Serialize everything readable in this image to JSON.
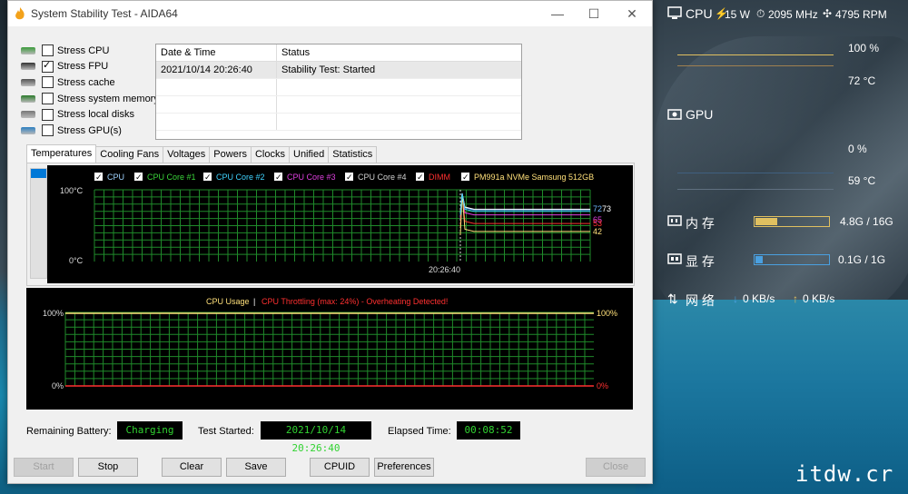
{
  "window": {
    "title": "System Stability Test - AIDA64"
  },
  "stress_options": [
    {
      "label": "Stress CPU",
      "checked": false,
      "icon": "cpu-chip-icon"
    },
    {
      "label": "Stress FPU",
      "checked": true,
      "icon": "fpu-123-icon"
    },
    {
      "label": "Stress cache",
      "checked": false,
      "icon": "cache-icon"
    },
    {
      "label": "Stress system memory",
      "checked": false,
      "icon": "memory-module-icon"
    },
    {
      "label": "Stress local disks",
      "checked": false,
      "icon": "disk-icon"
    },
    {
      "label": "Stress GPU(s)",
      "checked": false,
      "icon": "gpu-icon"
    }
  ],
  "log": {
    "col_datetime": "Date & Time",
    "col_status": "Status",
    "rows": [
      {
        "datetime": "2021/10/14 20:26:40",
        "status": "Stability Test: Started"
      }
    ]
  },
  "tabs": [
    "Temperatures",
    "Cooling Fans",
    "Voltages",
    "Powers",
    "Clocks",
    "Unified",
    "Statistics"
  ],
  "temp_chart": {
    "legend": [
      {
        "label": "CPU",
        "color": "#9fd3ff"
      },
      {
        "label": "CPU Core #1",
        "color": "#3ad43a"
      },
      {
        "label": "CPU Core #2",
        "color": "#3fd3ff"
      },
      {
        "label": "CPU Core #3",
        "color": "#e040e0"
      },
      {
        "label": "CPU Core #4",
        "color": "#d0d0d0"
      },
      {
        "label": "DIMM",
        "color": "#ff3030"
      },
      {
        "label": "PM991a NVMe Samsung 512GB",
        "color": "#ffe07a"
      }
    ],
    "y_top": "100°C",
    "y_bottom": "0°C",
    "x_label": "20:26:40",
    "values": [
      {
        "label": "72",
        "color": "#6fb8ff"
      },
      {
        "label": "73",
        "color": "#ffffff"
      },
      {
        "label": "65",
        "color": "#e040e0"
      },
      {
        "label": "53",
        "color": "#ff3030"
      },
      {
        "label": "42",
        "color": "#ffe07a"
      }
    ]
  },
  "usage_chart": {
    "title_left": "CPU Usage",
    "separator": "|",
    "title_right": "CPU Throttling (max: 24%) - Overheating Detected!",
    "left_top": "100%",
    "left_bottom": "0%",
    "right_top": "100%",
    "right_bottom": "0%"
  },
  "status_bar": {
    "battery_label": "Remaining Battery:",
    "battery_value": "Charging",
    "started_label": "Test Started:",
    "started_value": "2021/10/14 20:26:40",
    "elapsed_label": "Elapsed Time:",
    "elapsed_value": "00:08:52"
  },
  "buttons": {
    "start": "Start",
    "stop": "Stop",
    "clear": "Clear",
    "save": "Save",
    "cpuid": "CPUID",
    "preferences": "Preferences",
    "close": "Close"
  },
  "overlay": {
    "cpu_label": "CPU",
    "cpu_power": "15 W",
    "cpu_clock": "2095 MHz",
    "cpu_fan": "4795 RPM",
    "cpu_usage": "100 %",
    "cpu_temp": "72 °C",
    "gpu_label": "GPU",
    "gpu_usage": "0 %",
    "gpu_temp": "59 °C",
    "mem_label": "内 存",
    "mem_value": "4.8G / 16G",
    "vram_label": "显 存",
    "vram_value": "0.1G / 1G",
    "net_label": "网 络",
    "net_down": "0 KB/s",
    "net_up": "0 KB/s",
    "mem_fill": 0.3,
    "vram_fill": 0.1
  },
  "watermark": "itdw.cr"
}
